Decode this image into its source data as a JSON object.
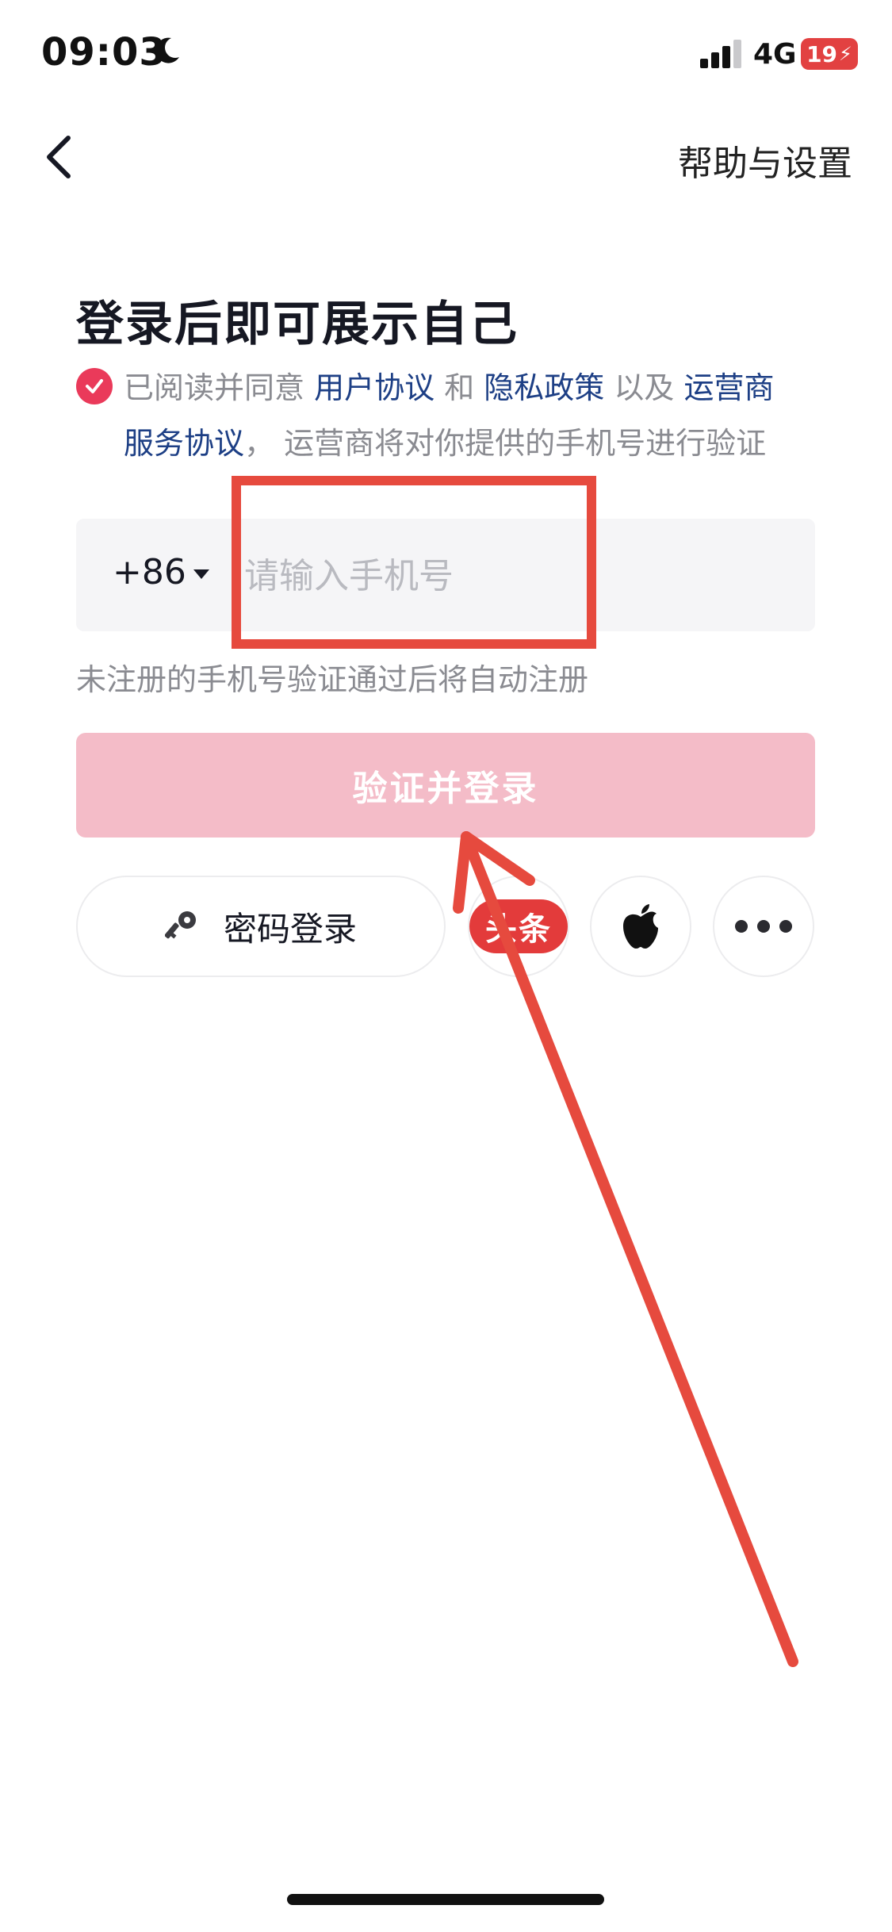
{
  "status_bar": {
    "time": "09:03",
    "network": "4G",
    "battery": "19"
  },
  "nav": {
    "help_label": "帮助与设置"
  },
  "title": "登录后即可展示自己",
  "agreement": {
    "prefix": "已阅读并同意 ",
    "user_agreement": "用户协议",
    "and": " 和 ",
    "privacy_policy": "隐私政策",
    "and_also": " 以及 ",
    "carrier_line1": "运营商",
    "carrier_line2": "服务协议",
    "suffix": "， 运营商将对你提供的手机号进行验证"
  },
  "phone": {
    "country_code": "+86",
    "placeholder": "请输入手机号"
  },
  "hint": "未注册的手机号验证通过后将自动注册",
  "login_button": "验证并登录",
  "alt_login": {
    "password_label": "密码登录",
    "toutiao_label": "头条"
  },
  "colors": {
    "accent": "#ea3a5a",
    "button_disabled": "#f4bcc8",
    "link": "#1d3f85",
    "annotation": "#e64a3e"
  }
}
